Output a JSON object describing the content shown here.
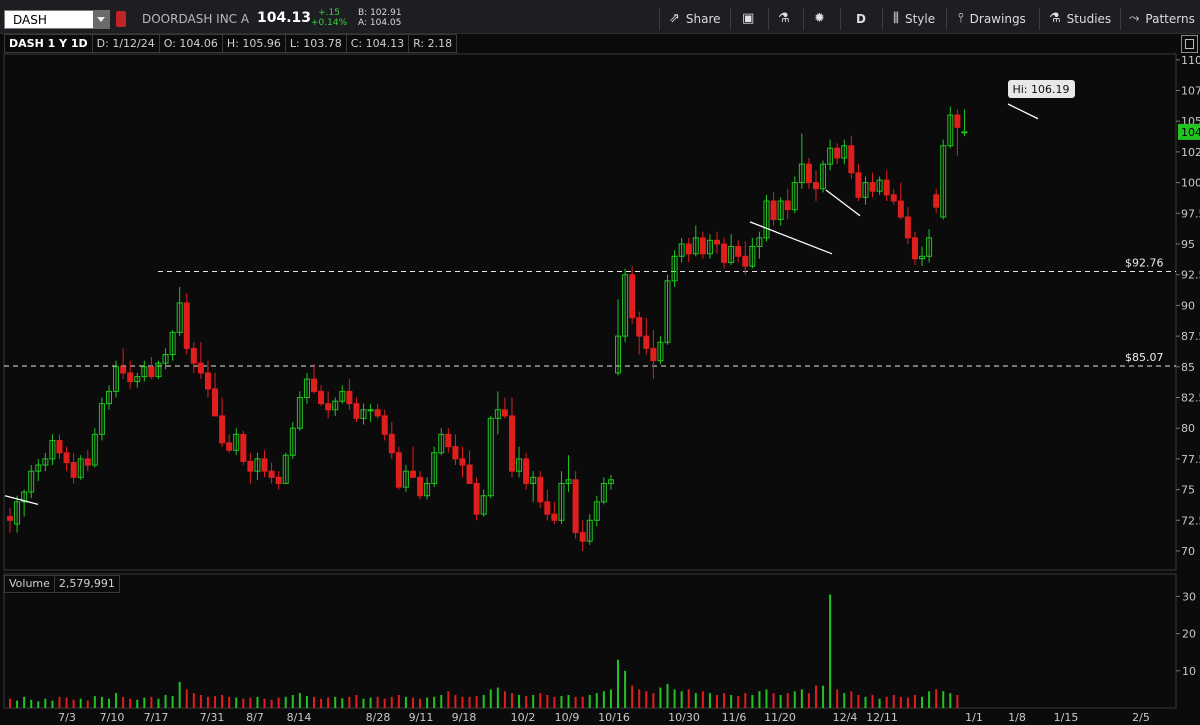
{
  "header": {
    "symbol": "DASH",
    "company": "DOORDASH INC A",
    "last": "104.13",
    "change": "+.15",
    "change_pct": "+0.14%",
    "bid": "B: 102.91",
    "ask": "A: 104.05",
    "share_label": "Share",
    "period_label": "D",
    "style_label": "Style",
    "drawings_label": "Drawings",
    "studies_label": "Studies",
    "patterns_label": "Patterns"
  },
  "info": {
    "title": "DASH 1 Y 1D",
    "date": "D: 1/12/24",
    "open": "O: 104.06",
    "high": "H: 105.96",
    "low": "L: 103.78",
    "close": "C: 104.13",
    "range": "R: 2.18"
  },
  "volume_panel": {
    "label": "Volume",
    "value": "2,579,991"
  },
  "annotations": {
    "hi_label": "Hi: 106.19",
    "level_upper": "$92.76",
    "level_lower": "$85.07",
    "price_tag": "104"
  },
  "colors": {
    "up": "#22c322",
    "down": "#e01e1e",
    "background": "#0b0b0b"
  },
  "chart_data": [
    {
      "type": "candlestick",
      "title": "DASH 1 Y 1D",
      "y_ticks": [
        110,
        107.5,
        105,
        102.5,
        100,
        97.5,
        95,
        92.5,
        90,
        87.5,
        85,
        82.5,
        80,
        77.5,
        75,
        72.5,
        70
      ],
      "y_tick_labels": [
        "110",
        "107.",
        "105",
        "102.",
        "100",
        "97.5",
        "95",
        "92.5",
        "90",
        "87.5",
        "85",
        "82.5",
        "80",
        "77.5",
        "75",
        "72.5",
        "70"
      ],
      "ylim": [
        68.2,
        110.4
      ],
      "x_tick_labels": [
        "7/3",
        "7/10",
        "7/17",
        "7/31",
        "8/7",
        "8/14",
        "8/28",
        "9/11",
        "9/18",
        "10/2",
        "10/9",
        "10/16",
        "10/30",
        "11/6",
        "11/20",
        "12/4",
        "12/11",
        "1/1",
        "1/8",
        "1/15",
        "2/5"
      ],
      "horizontal_levels": [
        92.76,
        85.07
      ],
      "candles": [
        [
          72.8,
          73.5,
          71.5,
          72.5
        ],
        [
          72.2,
          74.5,
          71.5,
          74
        ],
        [
          74,
          75,
          72.8,
          74.8
        ],
        [
          74.8,
          77,
          74.3,
          76.5
        ],
        [
          76.5,
          77.5,
          75.7,
          77
        ],
        [
          77,
          78,
          76.5,
          77.5
        ],
        [
          77.5,
          79.5,
          77,
          79
        ],
        [
          79,
          79.5,
          77.5,
          78
        ],
        [
          78,
          78.5,
          76.5,
          77.2
        ],
        [
          77.2,
          78,
          75.5,
          76
        ],
        [
          76,
          77.8,
          75.8,
          77.5
        ],
        [
          77.5,
          78.2,
          76.5,
          77
        ],
        [
          77,
          80,
          76.8,
          79.5
        ],
        [
          79.5,
          82.5,
          79,
          82
        ],
        [
          82,
          83.5,
          81.5,
          83
        ],
        [
          83,
          85.5,
          82.5,
          85
        ],
        [
          85,
          86.5,
          84,
          84.5
        ],
        [
          84.5,
          85.5,
          83.2,
          83.8
        ],
        [
          83.8,
          84.5,
          83.3,
          84.2
        ],
        [
          84.2,
          85.5,
          83.8,
          85
        ],
        [
          85,
          85.8,
          84,
          84.2
        ],
        [
          84.2,
          85.5,
          84,
          85.3
        ],
        [
          85.3,
          86.5,
          84.8,
          86
        ],
        [
          86,
          88,
          85.5,
          87.8
        ],
        [
          87.8,
          91.5,
          87.5,
          90.2
        ],
        [
          90.2,
          91,
          86,
          86.5
        ],
        [
          86.5,
          87,
          84.5,
          85.3
        ],
        [
          85.3,
          87,
          84,
          84.5
        ],
        [
          84.5,
          85.5,
          82.5,
          83.2
        ],
        [
          83.2,
          84.5,
          81,
          81
        ],
        [
          81,
          82.5,
          78.5,
          78.8
        ],
        [
          78.8,
          79.5,
          78,
          78.2
        ],
        [
          78.2,
          80,
          77.8,
          79.5
        ],
        [
          79.5,
          79.8,
          77,
          77.3
        ],
        [
          77.3,
          78,
          75.5,
          76.5
        ],
        [
          76.5,
          78,
          75.8,
          77.5
        ],
        [
          77.5,
          78.2,
          76,
          76.5
        ],
        [
          76.5,
          77.2,
          75.5,
          76
        ],
        [
          76,
          76.5,
          75,
          75.5
        ],
        [
          75.5,
          78,
          75.5,
          77.8
        ],
        [
          77.8,
          80.5,
          77.5,
          80
        ],
        [
          80,
          83,
          79.8,
          82.5
        ],
        [
          82.5,
          84.5,
          82,
          84
        ],
        [
          84,
          85.2,
          82.8,
          83
        ],
        [
          83,
          83.5,
          81.8,
          82
        ],
        [
          82,
          83,
          80.8,
          81.5
        ],
        [
          81.5,
          82.5,
          81,
          82.2
        ],
        [
          82.2,
          83.5,
          82,
          83
        ],
        [
          83,
          84,
          81.5,
          82
        ],
        [
          82,
          82.5,
          80.5,
          80.8
        ],
        [
          80.8,
          82,
          80.3,
          81.5
        ],
        [
          81.5,
          82,
          80.5,
          81.5
        ],
        [
          81.5,
          82,
          80.8,
          81
        ],
        [
          81,
          81.5,
          79,
          79.5
        ],
        [
          79.5,
          80.5,
          77.5,
          78
        ],
        [
          78,
          78.5,
          75,
          75.2
        ],
        [
          75.2,
          77,
          74.8,
          76.5
        ],
        [
          76.5,
          78.5,
          76,
          76
        ],
        [
          76,
          76.5,
          74.2,
          74.5
        ],
        [
          74.5,
          76,
          74.2,
          75.5
        ],
        [
          75.5,
          78.5,
          75.2,
          78
        ],
        [
          78,
          80,
          77.8,
          79.5
        ],
        [
          79.5,
          80,
          78,
          78.5
        ],
        [
          78.5,
          79.5,
          77,
          77.5
        ],
        [
          77.5,
          78.5,
          76,
          77
        ],
        [
          77,
          78.2,
          75.5,
          75.5
        ],
        [
          75.5,
          76,
          72.5,
          73
        ],
        [
          73,
          75,
          72.8,
          74.5
        ],
        [
          74.5,
          81,
          74.3,
          80.8
        ],
        [
          80.8,
          83,
          79.5,
          81.5
        ],
        [
          81.5,
          82.5,
          80.8,
          81
        ],
        [
          81,
          82.5,
          76,
          76.5
        ],
        [
          76.5,
          78.5,
          76,
          77.5
        ],
        [
          77.5,
          78,
          75,
          75.5
        ],
        [
          75.5,
          76.5,
          74,
          76
        ],
        [
          76,
          76.5,
          73.5,
          74
        ],
        [
          74,
          75,
          72.5,
          73
        ],
        [
          73,
          74,
          72.2,
          72.5
        ],
        [
          72.5,
          76.5,
          72.2,
          75.5
        ],
        [
          75.5,
          77.8,
          74.8,
          75.8
        ],
        [
          75.8,
          76.5,
          71,
          71.5
        ],
        [
          71.5,
          72.5,
          70,
          70.8
        ],
        [
          70.8,
          73,
          70.5,
          72.5
        ],
        [
          72.5,
          74.5,
          72,
          74
        ],
        [
          74,
          76,
          73.8,
          75.5
        ],
        [
          75.5,
          76.2,
          75,
          75.8
        ],
        [
          84.5,
          90.5,
          84.3,
          87.5
        ],
        [
          87.5,
          93,
          87,
          92.5
        ],
        [
          92.5,
          93.2,
          88.5,
          89
        ],
        [
          89,
          89.5,
          86,
          87.5
        ],
        [
          87.5,
          89,
          86,
          86.5
        ],
        [
          86.5,
          88,
          84,
          85.5
        ],
        [
          85.5,
          87.5,
          85.2,
          87
        ],
        [
          87,
          92.5,
          86.8,
          92
        ],
        [
          92,
          94.5,
          91.5,
          94
        ],
        [
          94,
          95.5,
          93.5,
          95
        ],
        [
          95,
          95.5,
          93.5,
          94.2
        ],
        [
          94.2,
          96.5,
          94,
          95.5
        ],
        [
          95.5,
          96,
          93.8,
          94.2
        ],
        [
          94.2,
          95.8,
          93.8,
          95.3
        ],
        [
          95.3,
          96,
          94.2,
          95
        ],
        [
          95,
          95.5,
          93,
          93.5
        ],
        [
          93.5,
          95.8,
          93.3,
          94.8
        ],
        [
          94.8,
          95.3,
          93.5,
          94
        ],
        [
          94,
          95.2,
          92.5,
          93.2
        ],
        [
          93.2,
          95.5,
          93,
          94.8
        ],
        [
          94.8,
          96,
          93.8,
          95.5
        ],
        [
          95.5,
          99,
          95.2,
          98.5
        ],
        [
          98.5,
          99.2,
          96.5,
          97
        ],
        [
          97,
          98.8,
          96.5,
          98.5
        ],
        [
          98.5,
          99.5,
          97,
          97.8
        ],
        [
          97.8,
          100.5,
          97.5,
          100
        ],
        [
          100,
          104,
          99.5,
          101.5
        ],
        [
          101.5,
          102,
          99.5,
          100
        ],
        [
          100,
          101,
          98.5,
          99.5
        ],
        [
          99.5,
          101.8,
          99.2,
          101.5
        ],
        [
          101.5,
          103.5,
          101,
          102.8
        ],
        [
          102.8,
          103.2,
          101.5,
          102
        ],
        [
          102,
          103.5,
          101.5,
          103
        ],
        [
          103,
          103.8,
          100.3,
          100.8
        ],
        [
          100.8,
          101.5,
          98.5,
          98.8
        ],
        [
          98.8,
          100.5,
          98.2,
          100
        ],
        [
          100,
          100.8,
          98.8,
          99.3
        ],
        [
          99.3,
          100.5,
          99,
          100.2
        ],
        [
          100.2,
          101,
          98.5,
          99
        ],
        [
          99,
          99.5,
          98.2,
          98.5
        ],
        [
          98.5,
          100,
          97,
          97.2
        ],
        [
          97.2,
          98,
          95,
          95.5
        ],
        [
          95.5,
          96,
          93.3,
          93.8
        ],
        [
          93.8,
          94.8,
          93.2,
          94
        ],
        [
          94,
          96.2,
          93.5,
          95.5
        ],
        [
          99,
          99.5,
          97.5,
          98
        ],
        [
          97.2,
          103.5,
          97,
          103
        ],
        [
          103,
          106.2,
          102.8,
          105.5
        ],
        [
          105.5,
          105.96,
          102.2,
          104.5
        ],
        [
          104.06,
          105.96,
          103.78,
          104.13
        ]
      ]
    },
    {
      "type": "bar",
      "title": "Volume",
      "y_ticks": [
        10,
        20,
        30
      ],
      "ylim": [
        0,
        32
      ],
      "values": [
        2.5,
        2,
        3,
        2.2,
        1.8,
        2.5,
        2,
        3,
        2.8,
        2.2,
        2.5,
        2,
        3.2,
        3,
        2.5,
        4,
        3,
        2.5,
        2.2,
        2.8,
        3,
        2.5,
        3.5,
        3.2,
        7,
        5,
        4,
        3.5,
        3,
        3.2,
        3.5,
        3,
        2.8,
        2.5,
        2.8,
        3,
        2.5,
        2.2,
        2.8,
        3,
        3.5,
        4,
        3.2,
        3,
        2.5,
        2.8,
        3,
        2.6,
        3,
        3.5,
        2.5,
        2.8,
        3,
        2.5,
        3,
        3.5,
        3,
        2.8,
        2.5,
        2.8,
        3,
        3.5,
        4.5,
        3.5,
        3,
        3,
        3.2,
        3.5,
        5,
        5.5,
        4.5,
        4,
        3.5,
        3.2,
        3.5,
        4,
        3.5,
        3,
        3.2,
        3.5,
        3,
        3,
        3.5,
        4,
        4.5,
        5,
        13,
        10,
        6,
        5,
        4.5,
        4,
        5.5,
        6.5,
        5,
        4.5,
        5,
        4,
        4.5,
        4,
        3.5,
        4,
        3.5,
        3.2,
        4,
        3.5,
        4.5,
        5,
        4,
        3.5,
        4,
        4.5,
        5,
        4,
        6,
        6,
        30.5,
        5,
        4,
        4.5,
        3.5,
        3,
        3.5,
        2.5,
        3,
        3.5,
        3,
        2.8,
        3.5,
        3,
        4.5,
        5,
        4.5,
        4,
        3.5
      ]
    }
  ]
}
